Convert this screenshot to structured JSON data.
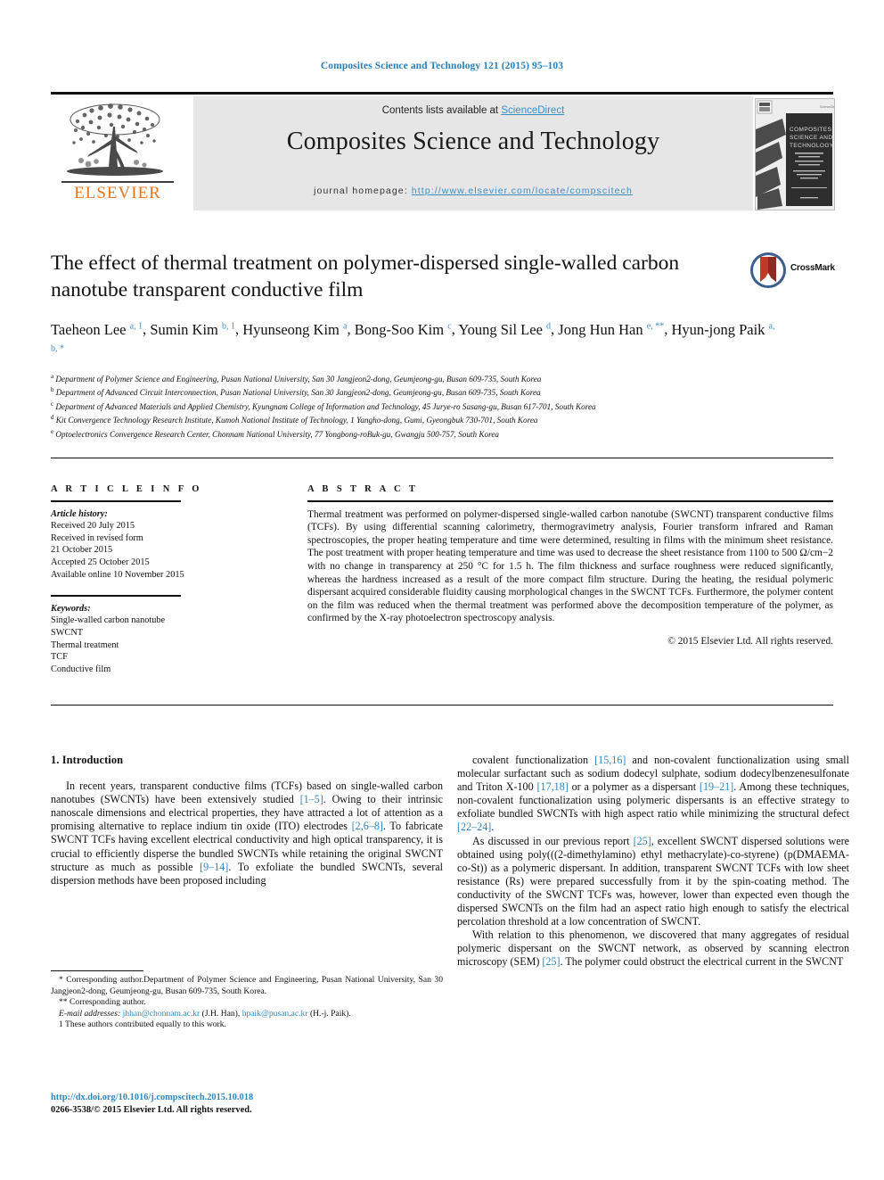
{
  "running_head": "Composites Science and Technology 121 (2015) 95–103",
  "masthead": {
    "contents_prefix": "Contents lists available at ",
    "sciencedirect": "ScienceDirect",
    "journal_title": "Composites Science and Technology",
    "homepage_label": "journal homepage:",
    "homepage_url": "http://www.elsevier.com/locate/compscitech",
    "publisher_logo_text": "ELSEVIER",
    "cover_title_lines": [
      "COMPOSITES",
      "SCIENCE AND",
      "TECHNOLOGY"
    ]
  },
  "article": {
    "title": "The effect of thermal treatment on polymer-dispersed single-walled carbon nanotube transparent conductive film",
    "crossmark_label": "CrossMark",
    "authors": [
      {
        "name": "Taeheon Lee",
        "marks": "a, 1"
      },
      {
        "name": "Sumin Kim",
        "marks": "b, 1"
      },
      {
        "name": "Hyunseong Kim",
        "marks": "a"
      },
      {
        "name": "Bong-Soo Kim",
        "marks": "c"
      },
      {
        "name": "Young Sil Lee",
        "marks": "d"
      },
      {
        "name": "Jong Hun Han",
        "marks": "e, **"
      },
      {
        "name": "Hyun-jong Paik",
        "marks": "a, b, *"
      }
    ],
    "affiliations": [
      {
        "mark": "a",
        "text": "Department of Polymer Science and Engineering, Pusan National University, San 30 Jangjeon2-dong, Geumjeong-gu, Busan 609-735, South Korea"
      },
      {
        "mark": "b",
        "text": "Department of Advanced Circuit Interconnection, Pusan National University, San 30 Jangjeon2-dong, Geumjeong-gu, Busan 609-735, South Korea"
      },
      {
        "mark": "c",
        "text": "Department of Advanced Materials and Applied Chemistry, Kyungnam College of Information and Technology, 45 Jurye-ro Sasang-gu, Busan 617-701, South Korea"
      },
      {
        "mark": "d",
        "text": "Kit Convergence Technology Research Institute, Kumoh National Institute of Technology, 1 Yangho-dong, Gumi, Gyeongbuk 730-701, South Korea"
      },
      {
        "mark": "e",
        "text": "Optoelectronics Convergence Research Center, Chonnam National University, 77 Yongbong-roBuk-gu, Gwangju 500-757, South Korea"
      }
    ]
  },
  "article_info": {
    "heading": "A R T I C L E   I N F O",
    "history_label": "Article history:",
    "history_lines": [
      "Received 20 July 2015",
      "Received in revised form",
      "21 October 2015",
      "Accepted 25 October 2015",
      "Available online 10 November 2015"
    ],
    "keywords_label": "Keywords:",
    "keywords": [
      "Single-walled carbon nanotube",
      "SWCNT",
      "Thermal treatment",
      "TCF",
      "Conductive film"
    ]
  },
  "abstract": {
    "heading": "A B S T R A C T",
    "text": "Thermal treatment was performed on polymer-dispersed single-walled carbon nanotube (SWCNT) transparent conductive films (TCFs). By using differential scanning calorimetry, thermogravimetry analysis, Fourier transform infrared and Raman spectroscopies, the proper heating temperature and time were determined, resulting in films with the minimum sheet resistance. The post treatment with proper heating temperature and time was used to decrease the sheet resistance from 1100 to 500 Ω/cm−2 with no change in transparency at 250 °C for 1.5 h. The film thickness and surface roughness were reduced significantly, whereas the hardness increased as a result of the more compact film structure. During the heating, the residual polymeric dispersant acquired considerable fluidity causing morphological changes in the SWCNT TCFs. Furthermore, the polymer content on the film was reduced when the thermal treatment was performed above the decomposition temperature of the polymer, as confirmed by the X-ray photoelectron spectroscopy analysis.",
    "copyright": "© 2015 Elsevier Ltd. All rights reserved."
  },
  "body": {
    "section_number_title": "1.  Introduction",
    "left_paragraph_1": "In recent years, transparent conductive films (TCFs) based on single-walled carbon nanotubes (SWCNTs) have been extensively studied [1–5]. Owing to their intrinsic nanoscale dimensions and electrical properties, they have attracted a lot of attention as a promising alternative to replace indium tin oxide (ITO) electrodes [2,6–8]. To fabricate SWCNT TCFs having excellent electrical conductivity and high optical transparency, it is crucial to efficiently disperse the bundled SWCNTs while retaining the original SWCNT structure as much as possible [9–14]. To exfoliate the bundled SWCNTs, several dispersion methods have been proposed including",
    "right_paragraph_1": "covalent functionalization [15,16] and non-covalent functionalization using small molecular surfactant such as sodium dodecyl sulphate, sodium dodecylbenzenesulfonate and Triton X-100 [17,18] or a polymer as a dispersant [19–21]. Among these techniques, non-covalent functionalization using polymeric dispersants is an effective strategy to exfoliate bundled SWCNTs with high aspect ratio while minimizing the structural defect [22–24].",
    "right_paragraph_2": "As discussed in our previous report [25], excellent SWCNT dispersed solutions were obtained using poly(((2-dimethylamino) ethyl methacrylate)-co-styrene) (p(DMAEMA-co-St)) as a polymeric dispersant. In addition, transparent SWCNT TCFs with low sheet resistance (Rs) were prepared successfully from it by the spin-coating method. The conductivity of the SWCNT TCFs was, however, lower than expected even though the dispersed SWCNTs on the film had an aspect ratio high enough to satisfy the electrical percolation threshold at a low concentration of SWCNT.",
    "right_paragraph_3": "With relation to this phenomenon, we discovered that many aggregates of residual polymeric dispersant on the SWCNT network, as observed by scanning electron microscopy (SEM) [25]. The polymer could obstruct the electrical current in the SWCNT"
  },
  "footnotes": {
    "star": "* Corresponding author.Department of Polymer Science and Engineering, Pusan National University, San 30 Jangjeon2-dong, Geumjeong-gu, Busan 609-735, South Korea.",
    "double_star": "** Corresponding author.",
    "email_label": "E-mail addresses:",
    "email_1": "jhhan@chonnam.ac.kr",
    "email_1_owner": "(J.H. Han),",
    "email_2": "hpaik@pusan.ac.kr",
    "email_2_owner": "(H.-j. Paik).",
    "equal_contrib": "1  These authors contributed equally to this work."
  },
  "footer": {
    "doi": "http://dx.doi.org/10.1016/j.compscitech.2015.10.018",
    "issn_line": "0266-3538/© 2015 Elsevier Ltd. All rights reserved."
  },
  "colors": {
    "link_blue": "#2f86bd",
    "elsevier_orange": "#E87722",
    "band_gray": "#e6e6e6"
  }
}
